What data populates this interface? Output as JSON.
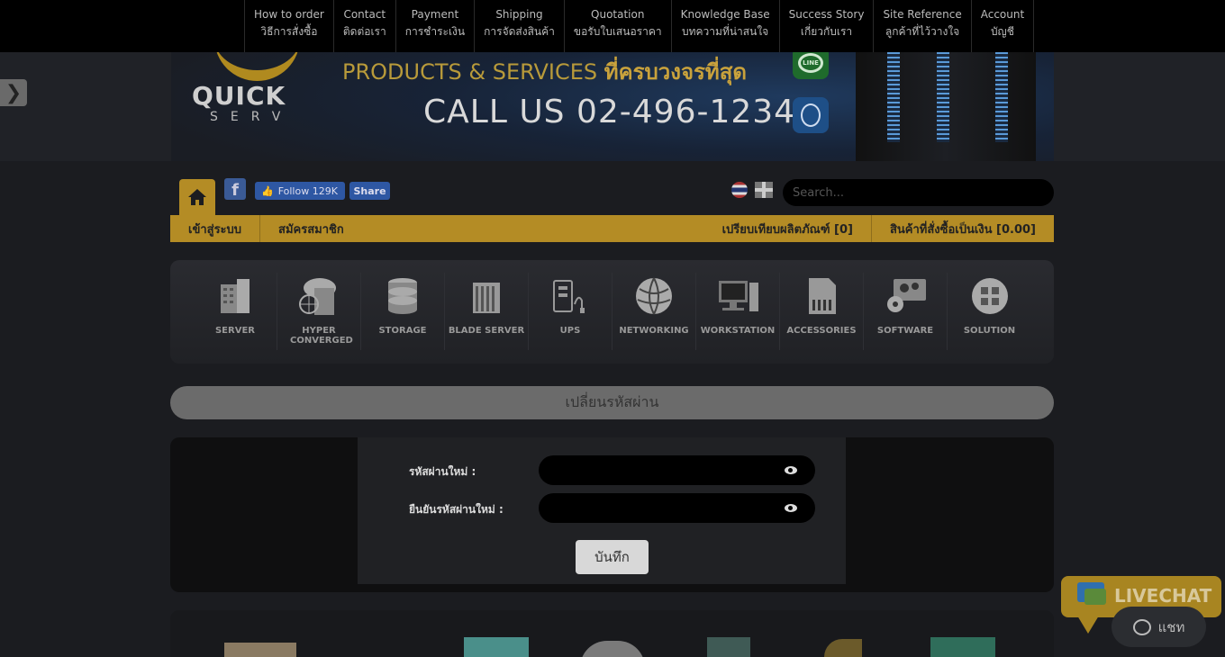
{
  "topnav": [
    {
      "en": "How to order",
      "th": "วิธีการสั่งซื้อ"
    },
    {
      "en": "Contact",
      "th": "ติดต่อเรา"
    },
    {
      "en": "Payment",
      "th": "การชำระเงิน"
    },
    {
      "en": "Shipping",
      "th": "การจัดส่งสินค้า"
    },
    {
      "en": "Quotation",
      "th": "ขอรับใบเสนอราคา"
    },
    {
      "en": "Knowledge Base",
      "th": "บทความที่น่าสนใจ"
    },
    {
      "en": "Success Story",
      "th": "เกี่ยวกับเรา"
    },
    {
      "en": "Site Reference",
      "th": "ลูกค้าที่ไว้วางใจ"
    },
    {
      "en": "Account",
      "th": "บัญชี"
    }
  ],
  "banner": {
    "logo_text": "QUICK",
    "logo_sub": "SERV",
    "tagline_en": "PRODUCTS & SERVICES",
    "tagline_th": "ที่ครบวงจรที่สุด",
    "call": "CALL US  02-496-1234",
    "line_label": "LINE"
  },
  "social": {
    "fb_letter": "f",
    "follow": "Follow 129K",
    "share": "Share"
  },
  "search": {
    "placeholder": "Search..."
  },
  "goldbar": {
    "login": "เข้าสู่ระบบ",
    "register": "สมัครสมาชิก",
    "compare": "เปรียบเทียบผลิตภัณฑ์ [0]",
    "cart": "สินค้าที่สั่งซื้อเป็นเงิน [0.00]"
  },
  "categories": [
    {
      "label": "SERVER",
      "icon": "server-icon"
    },
    {
      "label": "HYPER CONVERGED",
      "icon": "cloud-server-icon"
    },
    {
      "label": "STORAGE",
      "icon": "database-icon"
    },
    {
      "label": "BLADE SERVER",
      "icon": "blade-server-icon"
    },
    {
      "label": "UPS",
      "icon": "ups-icon"
    },
    {
      "label": "NETWORKING",
      "icon": "globe-icon"
    },
    {
      "label": "WORKSTATION",
      "icon": "workstation-icon"
    },
    {
      "label": "ACCESSORIES",
      "icon": "sd-card-icon"
    },
    {
      "label": "SOFTWARE",
      "icon": "software-icon"
    },
    {
      "label": "SOLUTION",
      "icon": "solution-icon"
    }
  ],
  "form": {
    "title": "เปลี่ยนรหัสผ่าน",
    "new_password_label": "รหัสผ่านใหม่ :",
    "confirm_password_label": "ยืนยันรหัสผ่านใหม่ :",
    "save": "บันทึก"
  },
  "livechat": {
    "title": "LIVECHAT",
    "chat": "แชท"
  }
}
